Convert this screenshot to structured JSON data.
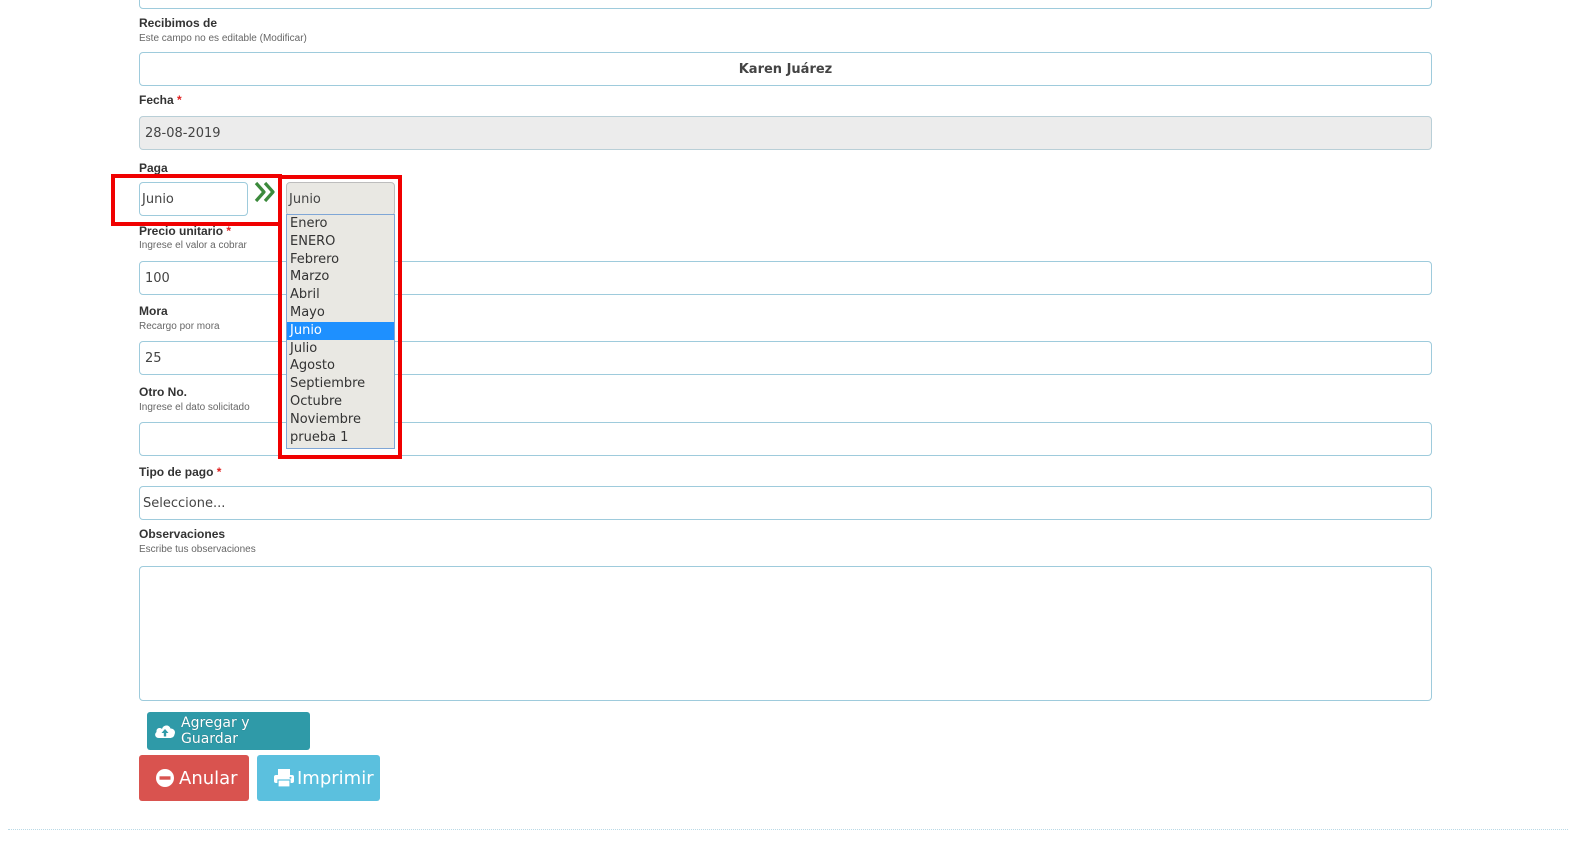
{
  "form": {
    "recibimos": {
      "label": "Recibimos de",
      "hint": "Este campo no es editable (Modificar)",
      "value": "Karen Juárez"
    },
    "fecha": {
      "label": "Fecha",
      "required": "*",
      "value": "28-08-2019"
    },
    "paga": {
      "label": "Paga",
      "input_value": "Junio",
      "select_value": "Junio",
      "options": [
        "Enero",
        "ENERO",
        "Febrero",
        "Marzo",
        "Abril",
        "Mayo",
        "Junio",
        "Julio",
        "Agosto",
        "Septiembre",
        "Octubre",
        "Noviembre",
        "prueba 1"
      ],
      "selected_option": "Junio"
    },
    "precio": {
      "label": "Precio unitario",
      "required": "*",
      "hint": "Ingrese el valor a cobrar",
      "value": "100"
    },
    "mora": {
      "label": "Mora",
      "hint": "Recargo por mora",
      "value": "25"
    },
    "otro": {
      "label": "Otro No.",
      "hint": "Ingrese el dato solicitado",
      "value": ""
    },
    "tipo_pago": {
      "label": "Tipo de pago",
      "required": "*",
      "value": "Seleccione..."
    },
    "observaciones": {
      "label": "Observaciones",
      "hint": "Escribe tus observaciones",
      "value": ""
    }
  },
  "buttons": {
    "agregar_guardar": "Agregar y Guardar",
    "anular": "Anular",
    "imprimir": "Imprimir"
  },
  "icons": {
    "double_chevron": "double-chevron-right-icon",
    "cloud_upload": "cloud-upload-icon",
    "minus_circle": "minus-circle-icon",
    "print": "print-icon"
  },
  "colors": {
    "highlight": "#f00000",
    "selected_option": "#1e90ff",
    "agregar_button": "#2f9aa8",
    "anular_button": "#d9534f",
    "imprimir_button": "#5bc0de",
    "chevron": "#3c8a3c"
  }
}
